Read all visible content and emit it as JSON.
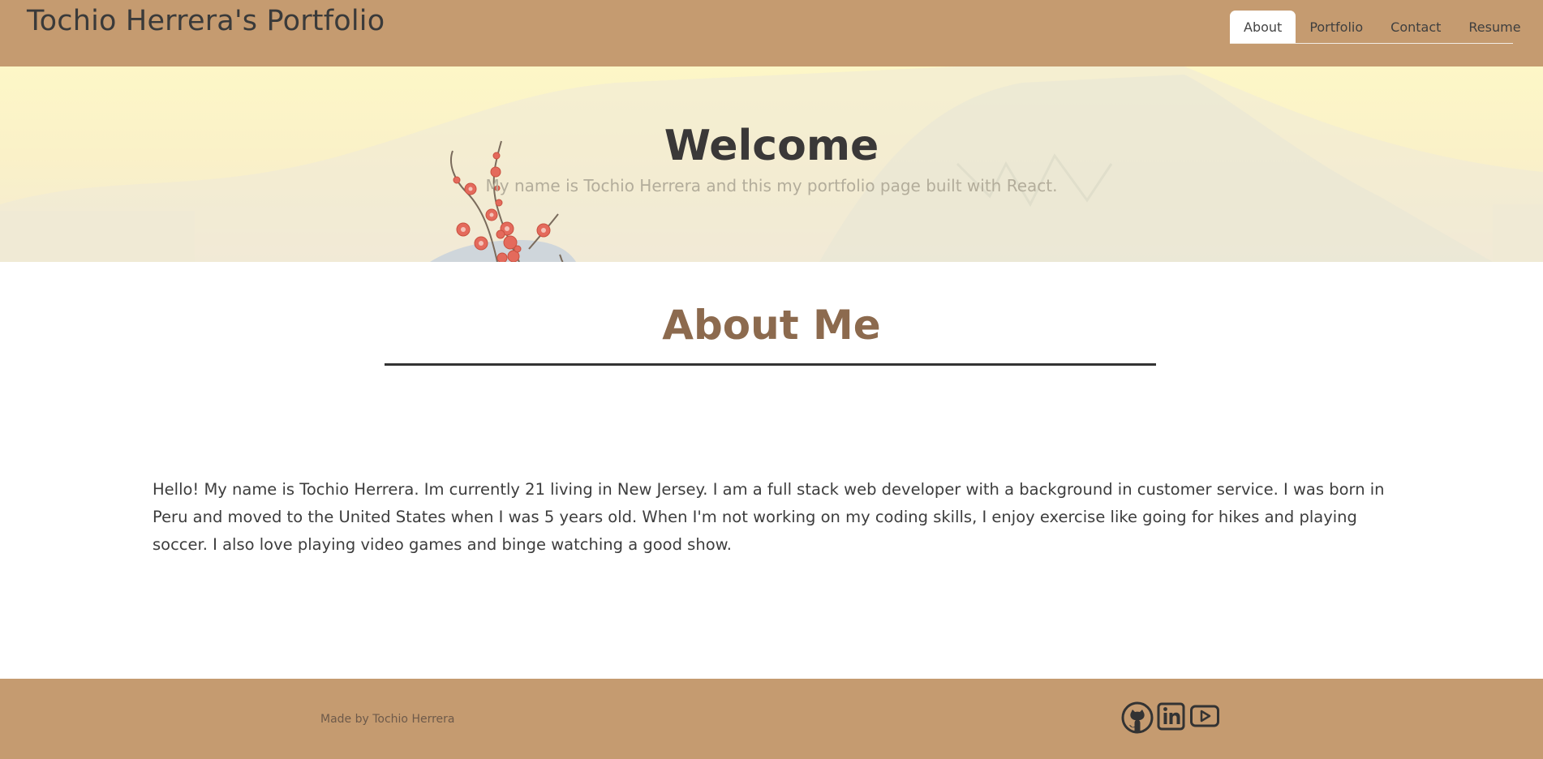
{
  "header": {
    "brand": "Tochio Herrera's Portfolio",
    "nav": [
      {
        "label": "About",
        "active": true
      },
      {
        "label": "Portfolio",
        "active": false
      },
      {
        "label": "Contact",
        "active": false
      },
      {
        "label": "Resume",
        "active": false
      }
    ]
  },
  "hero": {
    "title": "Welcome",
    "subtitle": "My name is Tochio Herrera and this my portfolio page built with React."
  },
  "about": {
    "title": "About Me",
    "body": "Hello! My name is Tochio Herrera. Im currently 21 living in New Jersey. I am a full stack web developer with a background in customer service. I was born in Peru and moved to the United States when I was 5 years old. When I'm not working on my coding skills, I enjoy exercise like going for hikes and playing soccer. I also love playing video games and binge watching a good show."
  },
  "footer": {
    "credit": "Made by Tochio Herrera",
    "social_icons": [
      "github-icon",
      "linkedin-icon",
      "youtube-icon"
    ]
  },
  "colors": {
    "header_bg": "#c59b70",
    "about_title": "#8c6a4e",
    "active_tab_bg": "#ffffff"
  }
}
